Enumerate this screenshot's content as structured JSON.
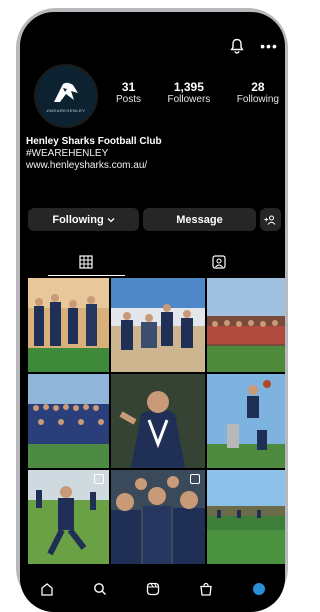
{
  "profile": {
    "avatar_caption": "#WEAREHENLEY",
    "stats": [
      {
        "value": "31",
        "label": "Posts"
      },
      {
        "value": "1,395",
        "label": "Followers"
      },
      {
        "value": "28",
        "label": "Following"
      }
    ],
    "name": "Henley Sharks Football Club",
    "hashtag": "#WEAREHENLEY",
    "website": "www.henleysharks.com.au/"
  },
  "actions": {
    "following_label": "Following",
    "message_label": "Message"
  },
  "colors": {
    "background": "#000000",
    "button_bg": "#262626",
    "team_navy": "#1f2f55"
  },
  "posts": [
    {
      "icon": "photo"
    },
    {
      "icon": "photo"
    },
    {
      "icon": "photo"
    },
    {
      "icon": "photo"
    },
    {
      "icon": "photo"
    },
    {
      "icon": "photo"
    },
    {
      "icon": "multi"
    },
    {
      "icon": "multi"
    },
    {
      "icon": "photo"
    }
  ]
}
